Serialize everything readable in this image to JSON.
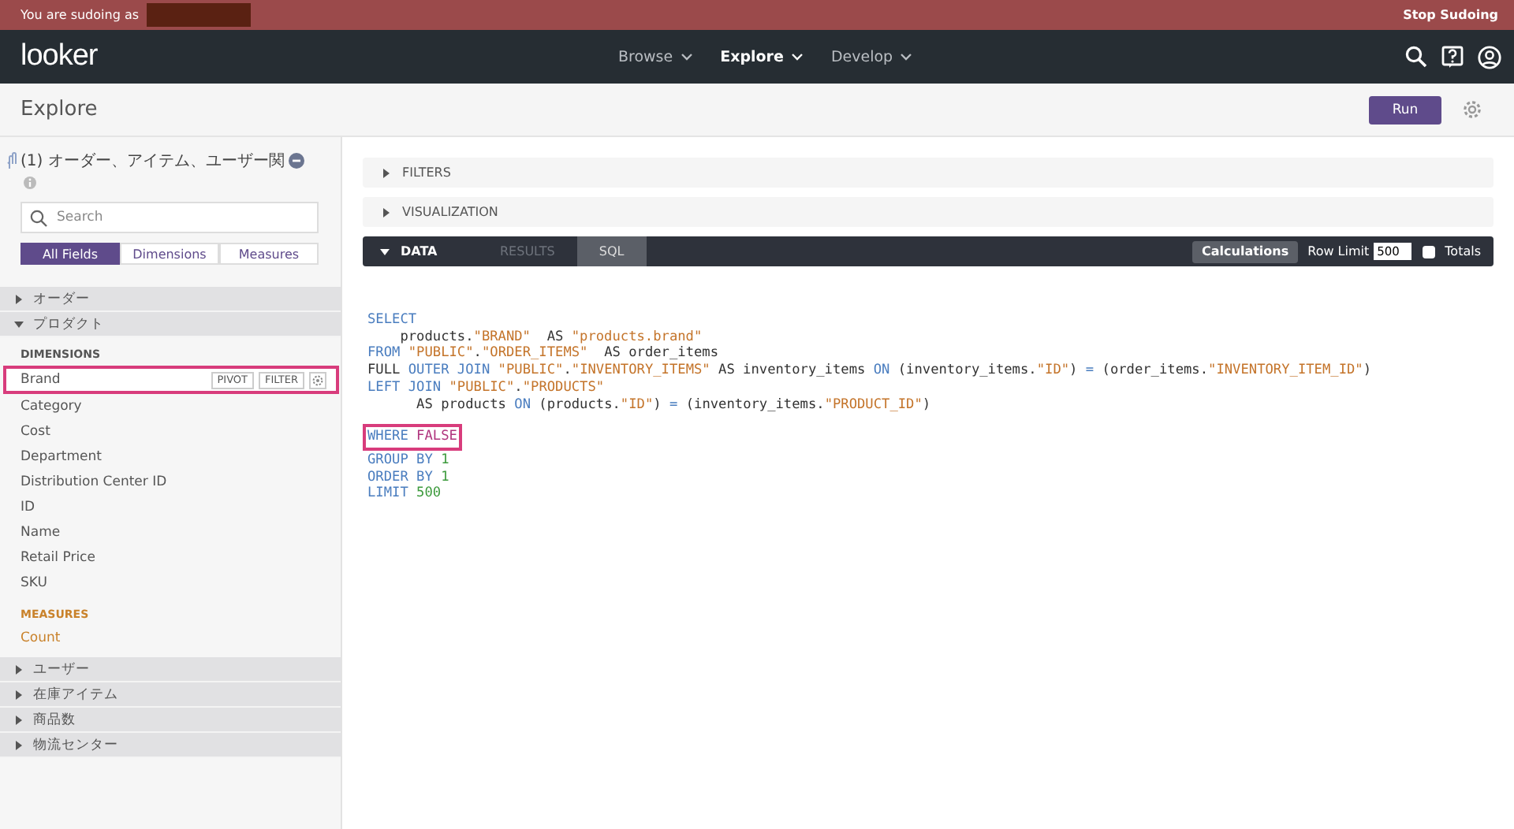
{
  "sudo_bar": {
    "message": "You are sudoing as",
    "stop_label": "Stop Sudoing"
  },
  "nav": {
    "logo": "looker",
    "menus": [
      {
        "label": "Browse",
        "selected": false
      },
      {
        "label": "Explore",
        "selected": true
      },
      {
        "label": "Develop",
        "selected": false
      }
    ]
  },
  "page": {
    "title": "Explore",
    "run_label": "Run"
  },
  "sidebar": {
    "model_title": "(1) オーダー、アイテム、ユーザー関",
    "search": {
      "placeholder": "Search"
    },
    "field_tabs": [
      {
        "label": "All Fields",
        "selected": true
      },
      {
        "label": "Dimensions",
        "selected": false
      },
      {
        "label": "Measures",
        "selected": false
      }
    ],
    "views": [
      {
        "label": "オーダー",
        "expanded": false
      },
      {
        "label": "プロダクト",
        "expanded": true,
        "groups": [
          {
            "kind": "dimension",
            "heading": "DIMENSIONS",
            "fields": [
              {
                "label": "Brand",
                "highlighted": true,
                "actions": [
                  "PIVOT",
                  "FILTER"
                ]
              },
              {
                "label": "Category",
                "highlighted": false
              },
              {
                "label": "Cost",
                "highlighted": false
              },
              {
                "label": "Department",
                "highlighted": false
              },
              {
                "label": "Distribution Center ID",
                "highlighted": false
              },
              {
                "label": "ID",
                "highlighted": false
              },
              {
                "label": "Name",
                "highlighted": false
              },
              {
                "label": "Retail Price",
                "highlighted": false
              },
              {
                "label": "SKU",
                "highlighted": false
              }
            ]
          },
          {
            "kind": "measure",
            "heading": "MEASURES",
            "fields": [
              {
                "label": "Count",
                "highlighted": false
              }
            ]
          }
        ]
      },
      {
        "label": "ユーザー",
        "expanded": false
      },
      {
        "label": "在庫アイテム",
        "expanded": false
      },
      {
        "label": "商品数",
        "expanded": false
      },
      {
        "label": "物流センター",
        "expanded": false
      }
    ]
  },
  "sections": [
    {
      "label": "FILTERS",
      "expanded": false
    },
    {
      "label": "VISUALIZATION",
      "expanded": false
    }
  ],
  "data_panel": {
    "label": "DATA",
    "expanded": true,
    "tabs": [
      {
        "label": "RESULTS",
        "selected": false
      },
      {
        "label": "SQL",
        "selected": true
      }
    ],
    "calculations_label": "Calculations",
    "row_limit": {
      "label": "Row Limit",
      "value": "500"
    },
    "totals": {
      "label": "Totals",
      "checked": false
    }
  },
  "sql": {
    "lines": [
      {
        "highlighted": false,
        "tokens": [
          {
            "kind": "keyword",
            "text": "SELECT"
          }
        ]
      },
      {
        "highlighted": false,
        "tokens": [
          {
            "kind": "plain",
            "text": "    products."
          },
          {
            "kind": "string",
            "text": "\"BRAND\""
          },
          {
            "kind": "plain",
            "text": "  AS "
          },
          {
            "kind": "string",
            "text": "\"products.brand\""
          }
        ]
      },
      {
        "highlighted": false,
        "tokens": [
          {
            "kind": "keyword",
            "text": "FROM "
          },
          {
            "kind": "string",
            "text": "\"PUBLIC\""
          },
          {
            "kind": "plain",
            "text": "."
          },
          {
            "kind": "string",
            "text": "\"ORDER_ITEMS\""
          },
          {
            "kind": "plain",
            "text": "  AS order_items"
          }
        ]
      },
      {
        "highlighted": false,
        "tokens": [
          {
            "kind": "plain",
            "text": "FULL "
          },
          {
            "kind": "keyword",
            "text": "OUTER JOIN "
          },
          {
            "kind": "string",
            "text": "\"PUBLIC\""
          },
          {
            "kind": "plain",
            "text": "."
          },
          {
            "kind": "string",
            "text": "\"INVENTORY_ITEMS\""
          },
          {
            "kind": "plain",
            "text": " AS inventory_items "
          },
          {
            "kind": "keyword",
            "text": "ON"
          },
          {
            "kind": "plain",
            "text": " (inventory_items."
          },
          {
            "kind": "string",
            "text": "\"ID\""
          },
          {
            "kind": "plain",
            "text": ") "
          },
          {
            "kind": "keyword",
            "text": "="
          },
          {
            "kind": "plain",
            "text": " (order_items."
          },
          {
            "kind": "string",
            "text": "\"INVENTORY_ITEM_ID\""
          },
          {
            "kind": "plain",
            "text": ")"
          }
        ]
      },
      {
        "highlighted": false,
        "tokens": [
          {
            "kind": "keyword",
            "text": "LEFT JOIN "
          },
          {
            "kind": "string",
            "text": "\"PUBLIC\""
          },
          {
            "kind": "plain",
            "text": "."
          },
          {
            "kind": "string",
            "text": "\"PRODUCTS\""
          }
        ]
      },
      {
        "highlighted": false,
        "tokens": [
          {
            "kind": "plain",
            "text": "      AS products "
          },
          {
            "kind": "keyword",
            "text": "ON"
          },
          {
            "kind": "plain",
            "text": " (products."
          },
          {
            "kind": "string",
            "text": "\"ID\""
          },
          {
            "kind": "plain",
            "text": ") "
          },
          {
            "kind": "keyword",
            "text": "="
          },
          {
            "kind": "plain",
            "text": " (inventory_items."
          },
          {
            "kind": "string",
            "text": "\"PRODUCT_ID\""
          },
          {
            "kind": "plain",
            "text": ")"
          }
        ]
      },
      {
        "highlighted": true,
        "gap_before": true,
        "tokens": [
          {
            "kind": "keyword",
            "text": "WHERE "
          },
          {
            "kind": "literal",
            "text": "FALSE"
          }
        ]
      },
      {
        "highlighted": false,
        "tokens": [
          {
            "kind": "keyword",
            "text": "GROUP BY "
          },
          {
            "kind": "number",
            "text": "1"
          }
        ]
      },
      {
        "highlighted": false,
        "tokens": [
          {
            "kind": "keyword",
            "text": "ORDER BY "
          },
          {
            "kind": "number",
            "text": "1"
          }
        ]
      },
      {
        "highlighted": false,
        "tokens": [
          {
            "kind": "keyword",
            "text": "LIMIT "
          },
          {
            "kind": "number",
            "text": "500"
          }
        ]
      }
    ]
  }
}
